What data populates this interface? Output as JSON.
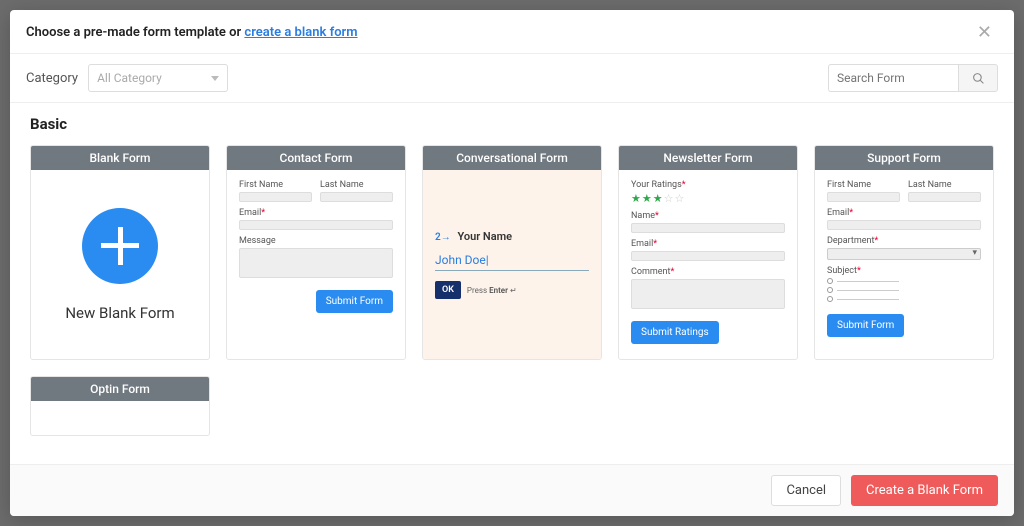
{
  "header": {
    "prompt_prefix": "Choose a pre-made form template or ",
    "prompt_link": "create a blank form"
  },
  "toolbar": {
    "category_label": "Category",
    "category_placeholder": "All Category",
    "search_placeholder": "Search Form"
  },
  "section": {
    "title": "Basic"
  },
  "templates": {
    "blank": {
      "head": "Blank Form",
      "label": "New Blank Form"
    },
    "contact": {
      "head": "Contact Form",
      "fields": {
        "first": "First Name",
        "last": "Last Name",
        "email": "Email",
        "message": "Message"
      },
      "submit": "Submit Form"
    },
    "conversational": {
      "head": "Conversational Form",
      "step_num": "2→",
      "question": "Your Name",
      "value": "John Doe",
      "ok": "OK",
      "hint_prefix": "Press ",
      "hint_key": "Enter",
      "hint_suffix": " ↵"
    },
    "newsletter": {
      "head": "Newsletter Form",
      "fields": {
        "ratings": "Your Ratings",
        "name": "Name",
        "email": "Email",
        "comment": "Comment"
      },
      "rating_value": 3,
      "rating_max": 5,
      "submit": "Submit Ratings"
    },
    "support": {
      "head": "Support Form",
      "fields": {
        "first": "First Name",
        "last": "Last Name",
        "email": "Email",
        "department": "Department",
        "subject": "Subject"
      },
      "submit": "Submit Form"
    },
    "optin": {
      "head": "Optin Form"
    }
  },
  "footer": {
    "cancel": "Cancel",
    "create": "Create a Blank Form"
  }
}
